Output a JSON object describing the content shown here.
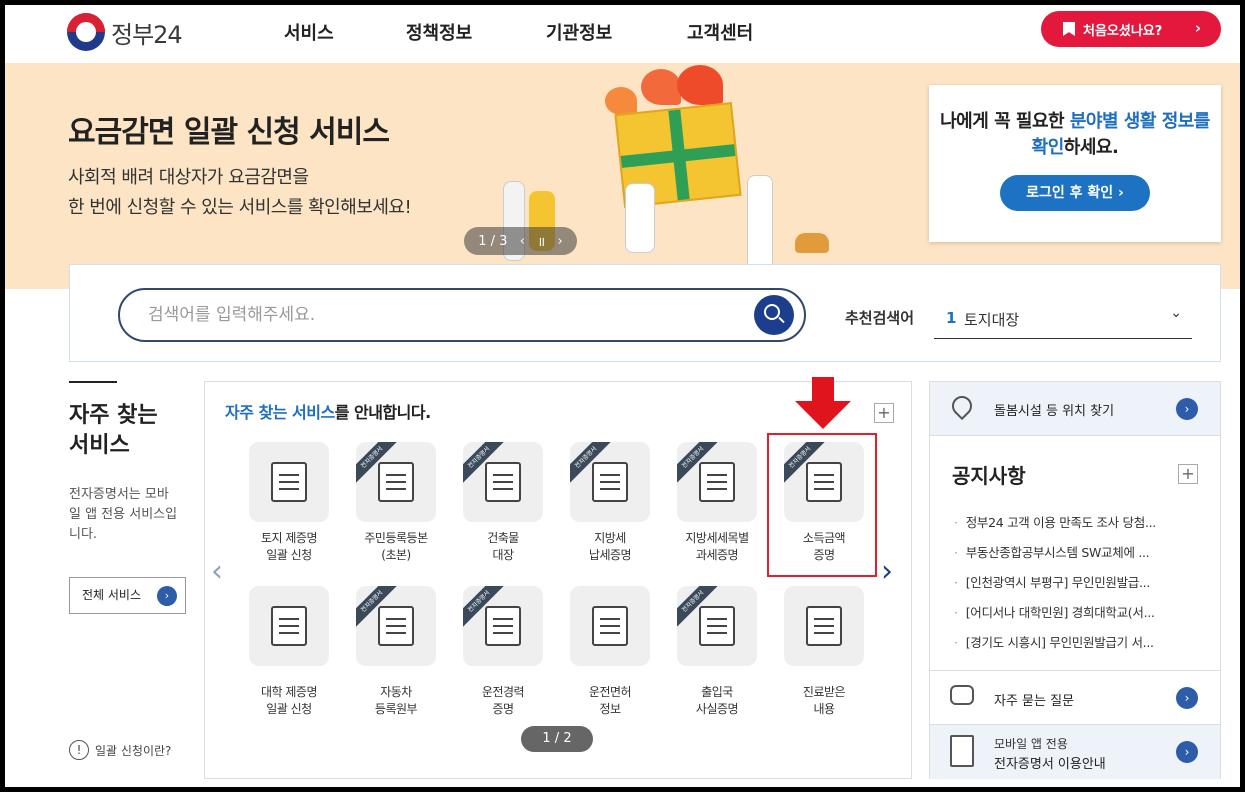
{
  "header": {
    "logo_text": "정부24",
    "nav": [
      "서비스",
      "정책정보",
      "기관정보",
      "고객센터"
    ],
    "first_visit_label": "처음오셨나요?",
    "first_visit_chevron": "›"
  },
  "banner": {
    "title": "요금감면 일괄 신청 서비스",
    "subtitle_line1": "사회적 배려 대상자가 요금감면을",
    "subtitle_line2": "한 번에 신청할 수 있는 서비스를 확인해보세요!",
    "slide_counter": "1 / 3",
    "prev": "‹",
    "pause": "॥",
    "next": "›"
  },
  "login_card": {
    "msg_prefix": "나에게 꼭 필요한 ",
    "msg_highlight": "분야별 생활 정보를 확인",
    "msg_suffix": "하세요.",
    "button": "로그인 후 확인 ›"
  },
  "search": {
    "placeholder": "검색어를 입력해주세요.",
    "value": "",
    "recommend_label": "추천검색어",
    "recommend_rank": "1",
    "recommend_value": "토지대장",
    "dropdown_chevron": "⌄"
  },
  "frequent": {
    "title_line1": "자주 찾는",
    "title_line2": "서비스",
    "desc": "전자증명서는 모바일 앱 전용 서비스입니다.",
    "all_button": "전체 서비스",
    "bulk_link": "일괄 신청이란?",
    "bulk_icon": "!"
  },
  "services": {
    "title_highlight": "자주 찾는 서비스",
    "title_rest": "를 안내합니다.",
    "plus": "+",
    "ribbon_text": "전자증명서",
    "prev_arrow": "‹",
    "next_arrow": "›",
    "pager": "1 / 2",
    "items": [
      {
        "line1": "토지 제증명",
        "line2": "일괄 신청",
        "icon": "land-map-icon",
        "ribbon": false
      },
      {
        "line1": "주민등록등본",
        "line2": "(초본)",
        "icon": "id-card-icon",
        "ribbon": true
      },
      {
        "line1": "건축물",
        "line2": "대장",
        "icon": "building-doc-icon",
        "ribbon": true
      },
      {
        "line1": "지방세",
        "line2": "납세증명",
        "icon": "tax-doc-icon",
        "ribbon": true
      },
      {
        "line1": "지방세세목별",
        "line2": "과세증명",
        "icon": "chart-board-icon",
        "ribbon": true
      },
      {
        "line1": "소득금액",
        "line2": "증명",
        "icon": "coin-stack-icon",
        "ribbon": true
      },
      {
        "line1": "대학 제증명",
        "line2": "일괄 신청",
        "icon": "graduation-cap-icon",
        "ribbon": false
      },
      {
        "line1": "자동차",
        "line2": "등록원부",
        "icon": "car-doc-icon",
        "ribbon": true
      },
      {
        "line1": "운전경력",
        "line2": "증명",
        "icon": "car-record-icon",
        "ribbon": true
      },
      {
        "line1": "운전면허",
        "line2": "정보",
        "icon": "license-card-icon",
        "ribbon": false
      },
      {
        "line1": "출입국",
        "line2": "사실증명",
        "icon": "passport-icon",
        "ribbon": true
      },
      {
        "line1": "진료받은",
        "line2": "내용",
        "icon": "stethoscope-icon",
        "ribbon": false
      }
    ]
  },
  "right": {
    "care_label": "돌봄시설 등 위치 찾기",
    "notice_title": "공지사항",
    "notice_plus": "+",
    "notices": [
      "정부24 고객 이용 만족도 조사 당첨...",
      "부동산종합공부시스템 SW교체에 ...",
      "[인천광역시 부평구] 무인민원발급...",
      "[어디서나 대학민원] 경희대학교(서...",
      "[경기도 시흥시] 무인민원발급기 서..."
    ],
    "faq_label": "자주 묻는 질문",
    "mobile_line1": "모바일 앱 전용",
    "mobile_line2": "전자증명서 이용안내",
    "go": "›"
  },
  "colors": {
    "brand_red": "#e4183d",
    "accent_blue": "#1d72c4",
    "navy": "#1d3e8c",
    "highlight_box": "#d9232d"
  }
}
